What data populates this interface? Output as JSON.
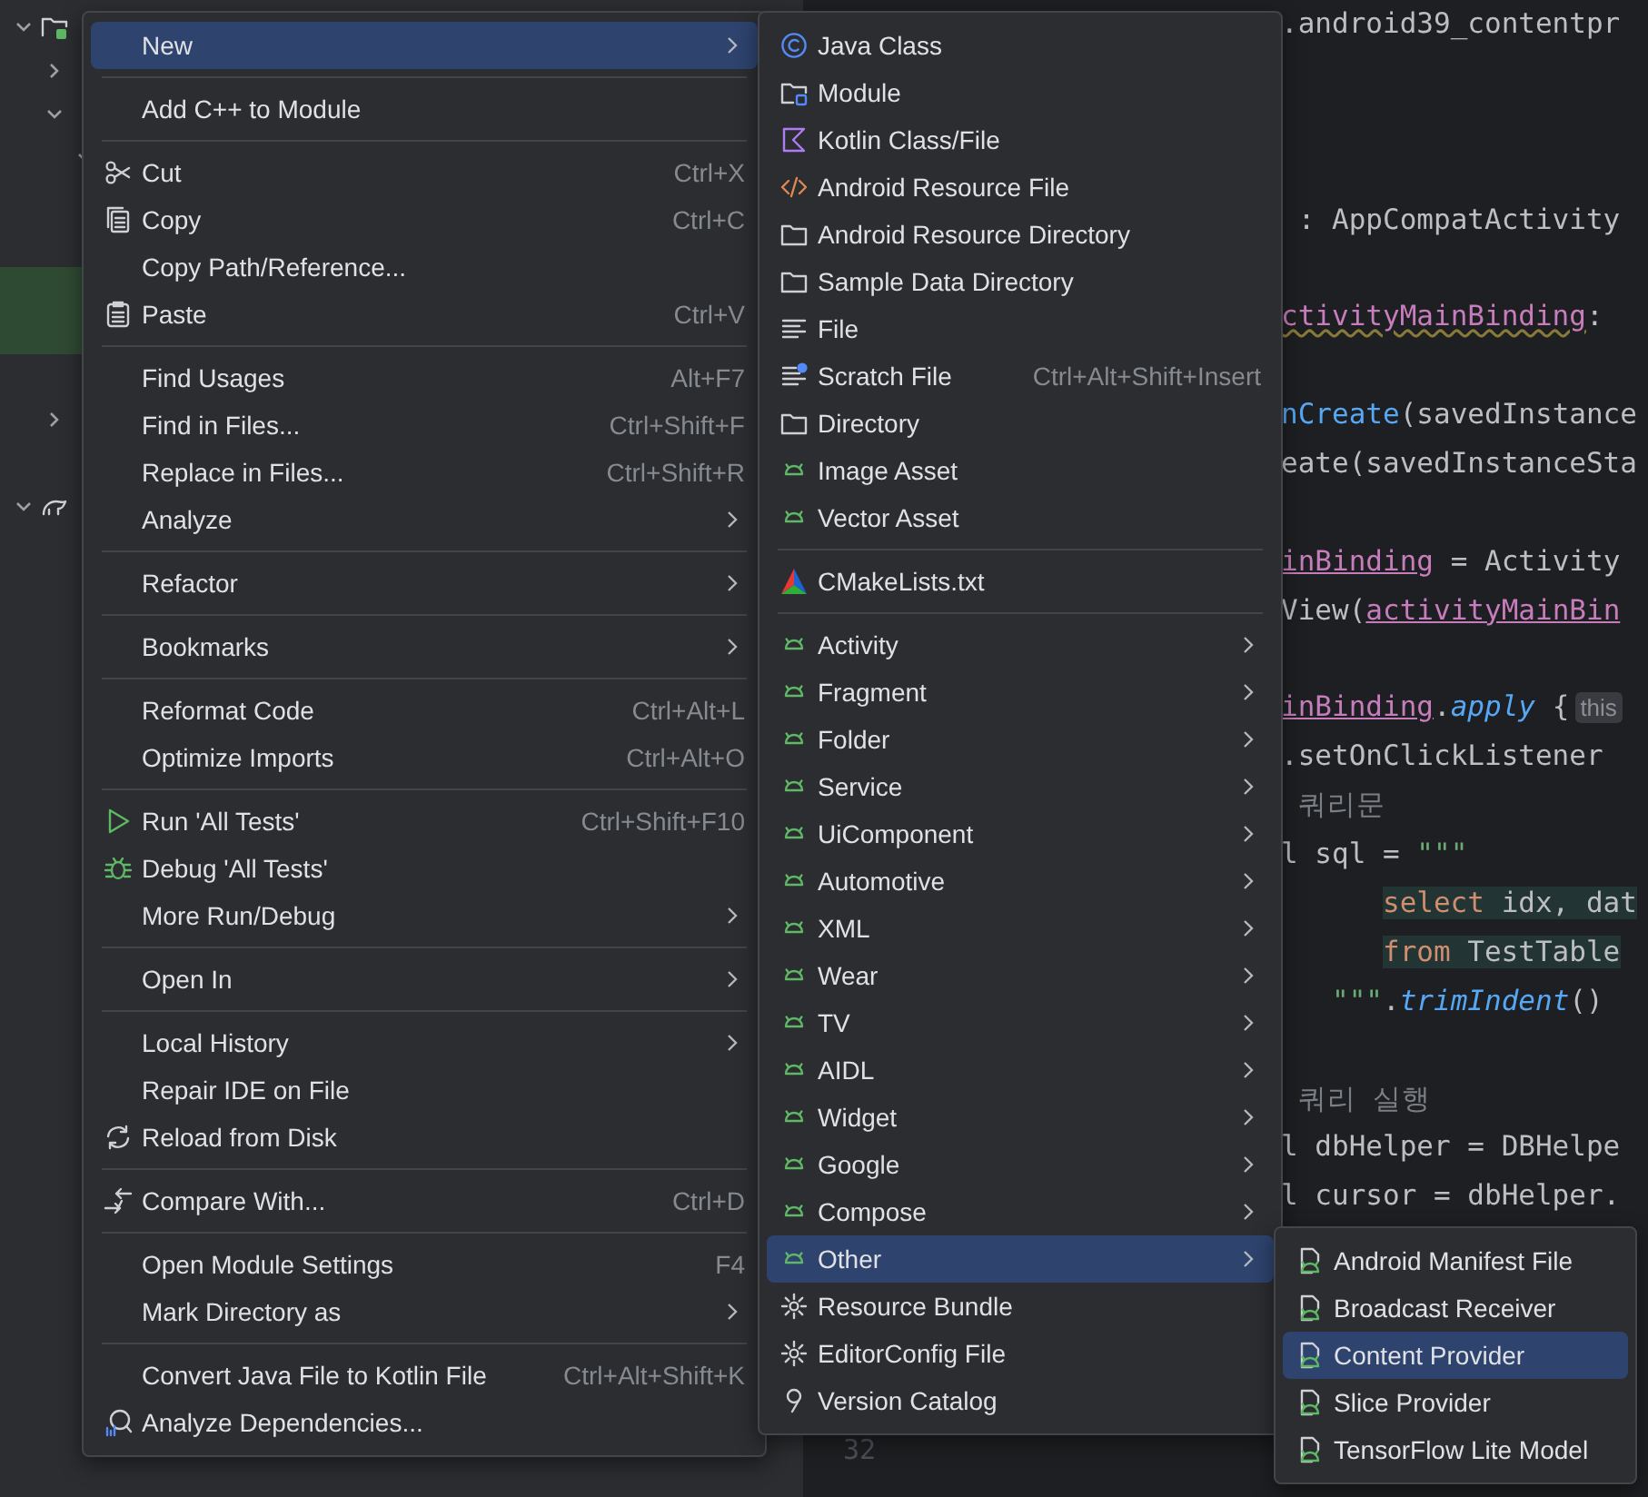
{
  "project_tree": [
    {
      "kind": "module",
      "expanded": true,
      "highlighted": false,
      "children": [
        {
          "expanded": false,
          "highlighted": false
        },
        {
          "expanded": true,
          "highlighted": false,
          "children": [
            {
              "expanded": true,
              "highlighted": false,
              "children": [
                {
                  "highlighted": false
                },
                {
                  "highlighted": false
                },
                {
                  "highlighted": true
                },
                {
                  "highlighted": true
                }
              ]
            }
          ]
        },
        {
          "highlighted": false
        },
        {
          "expanded": false,
          "highlighted": false
        },
        {
          "highlighted": false
        }
      ]
    },
    {
      "kind": "gradle",
      "expanded": true,
      "highlighted": false,
      "children": [
        {
          "highlighted": false
        },
        {
          "highlighted": false
        },
        {
          "highlighted": false
        },
        {
          "highlighted": false
        },
        {
          "highlighted": false
        },
        {
          "highlighted": false
        },
        {
          "highlighted": false
        }
      ]
    }
  ],
  "editor": {
    "code_lines": [
      {
        "kind": "code",
        "segments": [
          {
            "text": ".android39_contentpr",
            "kind": "plain"
          }
        ]
      },
      {
        "kind": "blank"
      },
      {
        "kind": "blank"
      },
      {
        "kind": "blank"
      },
      {
        "kind": "code",
        "segments": [
          {
            "text": " : AppCompatActivity",
            "kind": "plain"
          }
        ]
      },
      {
        "kind": "blank"
      },
      {
        "kind": "code",
        "segments": [
          {
            "text": "ctivityMainBinding",
            "kind": "property-warn"
          },
          {
            "text": ": ",
            "kind": "plain"
          }
        ]
      },
      {
        "kind": "blank"
      },
      {
        "kind": "code",
        "segments": [
          {
            "text": "nCreate",
            "kind": "function"
          },
          {
            "text": "(savedInstance",
            "kind": "plain"
          }
        ]
      },
      {
        "kind": "code",
        "segments": [
          {
            "text": "eate(savedInstanceSta",
            "kind": "plain"
          }
        ]
      },
      {
        "kind": "blank"
      },
      {
        "kind": "code",
        "segments": [
          {
            "text": "inBinding",
            "kind": "property"
          },
          {
            "text": " = Activity",
            "kind": "plain"
          }
        ]
      },
      {
        "kind": "code",
        "segments": [
          {
            "text": "View(",
            "kind": "plain"
          },
          {
            "text": "activityMainBin",
            "kind": "property"
          }
        ]
      },
      {
        "kind": "blank"
      },
      {
        "kind": "code",
        "segments": [
          {
            "text": "inBinding",
            "kind": "property"
          },
          {
            "text": ".",
            "kind": "plain"
          },
          {
            "text": "apply",
            "kind": "call"
          },
          {
            "text": " {",
            "kind": "plain"
          },
          {
            "text": "this",
            "kind": "hint"
          }
        ]
      },
      {
        "kind": "code",
        "segments": [
          {
            "text": ".setOnClickListener",
            "kind": "plain"
          }
        ]
      },
      {
        "kind": "code",
        "segments": [
          {
            "text": " 쿼리문",
            "kind": "comment"
          }
        ]
      },
      {
        "kind": "code",
        "segments": [
          {
            "text": "l sql = ",
            "kind": "plain"
          },
          {
            "text": "\"\"\"",
            "kind": "string"
          }
        ]
      },
      {
        "kind": "indented",
        "segments": [
          {
            "text": "select",
            "kind": "sql-keyword"
          },
          {
            "text": " idx, dat",
            "kind": "sql"
          }
        ]
      },
      {
        "kind": "indented",
        "segments": [
          {
            "text": "from",
            "kind": "sql-keyword"
          },
          {
            "text": " TestTable",
            "kind": "sql"
          }
        ]
      },
      {
        "kind": "half-indented",
        "segments": [
          {
            "text": "\"\"\"",
            "kind": "string"
          },
          {
            "text": ".",
            "kind": "plain"
          },
          {
            "text": "trimIndent",
            "kind": "call"
          },
          {
            "text": "()",
            "kind": "plain"
          }
        ]
      },
      {
        "kind": "blank"
      },
      {
        "kind": "code",
        "segments": [
          {
            "text": " 쿼리 실행",
            "kind": "comment"
          }
        ]
      },
      {
        "kind": "code",
        "segments": [
          {
            "text": "l dbHelper = DBHelpe",
            "kind": "plain"
          }
        ]
      },
      {
        "kind": "code",
        "segments": [
          {
            "text": "l cursor = dbHelper.",
            "kind": "plain"
          }
        ]
      }
    ],
    "line_number": "32"
  },
  "context_menu": {
    "items": [
      {
        "kind": "plain",
        "label": "New",
        "submenu": true,
        "selected": true
      },
      {
        "kind": "separator"
      },
      {
        "kind": "plain",
        "label": "Add C++ to Module",
        "submenu": false,
        "selected": false
      },
      {
        "kind": "separator"
      },
      {
        "kind": "scissors",
        "label": "Cut",
        "shortcut": "Ctrl+X",
        "submenu": false,
        "selected": false
      },
      {
        "kind": "copy",
        "label": "Copy",
        "shortcut": "Ctrl+C",
        "submenu": false,
        "selected": false
      },
      {
        "kind": "plain",
        "label": "Copy Path/Reference...",
        "submenu": false,
        "selected": false
      },
      {
        "kind": "paste",
        "label": "Paste",
        "shortcut": "Ctrl+V",
        "submenu": false,
        "selected": false
      },
      {
        "kind": "separator"
      },
      {
        "kind": "plain",
        "label": "Find Usages",
        "shortcut": "Alt+F7",
        "submenu": false,
        "selected": false
      },
      {
        "kind": "plain",
        "label": "Find in Files...",
        "shortcut": "Ctrl+Shift+F",
        "submenu": false,
        "selected": false
      },
      {
        "kind": "plain",
        "label": "Replace in Files...",
        "shortcut": "Ctrl+Shift+R",
        "submenu": false,
        "selected": false
      },
      {
        "kind": "plain",
        "label": "Analyze",
        "submenu": true,
        "selected": false
      },
      {
        "kind": "separator"
      },
      {
        "kind": "plain",
        "label": "Refactor",
        "submenu": true,
        "selected": false
      },
      {
        "kind": "separator"
      },
      {
        "kind": "plain",
        "label": "Bookmarks",
        "submenu": true,
        "selected": false
      },
      {
        "kind": "separator"
      },
      {
        "kind": "plain",
        "label": "Reformat Code",
        "shortcut": "Ctrl+Alt+L",
        "submenu": false,
        "selected": false
      },
      {
        "kind": "plain",
        "label": "Optimize Imports",
        "shortcut": "Ctrl+Alt+O",
        "submenu": false,
        "selected": false
      },
      {
        "kind": "separator"
      },
      {
        "kind": "run",
        "label": "Run 'All Tests'",
        "shortcut": "Ctrl+Shift+F10",
        "submenu": false,
        "selected": false
      },
      {
        "kind": "debug",
        "label": "Debug 'All Tests'",
        "submenu": false,
        "selected": false
      },
      {
        "kind": "plain",
        "label": "More Run/Debug",
        "submenu": true,
        "selected": false
      },
      {
        "kind": "separator"
      },
      {
        "kind": "plain",
        "label": "Open In",
        "submenu": true,
        "selected": false
      },
      {
        "kind": "separator"
      },
      {
        "kind": "plain",
        "label": "Local History",
        "submenu": true,
        "selected": false
      },
      {
        "kind": "plain",
        "label": "Repair IDE on File",
        "submenu": false,
        "selected": false
      },
      {
        "kind": "reload",
        "label": "Reload from Disk",
        "submenu": false,
        "selected": false
      },
      {
        "kind": "separator"
      },
      {
        "kind": "compare",
        "label": "Compare With...",
        "shortcut": "Ctrl+D",
        "submenu": false,
        "selected": false
      },
      {
        "kind": "separator"
      },
      {
        "kind": "plain",
        "label": "Open Module Settings",
        "shortcut": "F4",
        "submenu": false,
        "selected": false
      },
      {
        "kind": "plain",
        "label": "Mark Directory as",
        "submenu": true,
        "selected": false
      },
      {
        "kind": "separator"
      },
      {
        "kind": "plain",
        "label": "Convert Java File to Kotlin File",
        "shortcut": "Ctrl+Alt+Shift+K",
        "submenu": false,
        "selected": false
      },
      {
        "kind": "analyze",
        "label": "Analyze Dependencies...",
        "submenu": false,
        "selected": false
      }
    ]
  },
  "new_submenu": {
    "items": [
      {
        "kind": "java-class",
        "label": "Java Class",
        "submenu": false,
        "selected": false
      },
      {
        "kind": "module",
        "label": "Module",
        "submenu": false,
        "selected": false
      },
      {
        "kind": "kotlin",
        "label": "Kotlin Class/File",
        "submenu": false,
        "selected": false
      },
      {
        "kind": "xml",
        "label": "Android Resource File",
        "submenu": false,
        "selected": false
      },
      {
        "kind": "folder",
        "label": "Android Resource Directory",
        "submenu": false,
        "selected": false
      },
      {
        "kind": "folder",
        "label": "Sample Data Directory",
        "submenu": false,
        "selected": false
      },
      {
        "kind": "file",
        "label": "File",
        "submenu": false,
        "selected": false
      },
      {
        "kind": "scratch",
        "label": "Scratch File",
        "shortcut": "Ctrl+Alt+Shift+Insert",
        "submenu": false,
        "selected": false
      },
      {
        "kind": "folder",
        "label": "Directory",
        "submenu": false,
        "selected": false
      },
      {
        "kind": "android",
        "label": "Image Asset",
        "submenu": false,
        "selected": false
      },
      {
        "kind": "android",
        "label": "Vector Asset",
        "submenu": false,
        "selected": false
      },
      {
        "kind": "separator"
      },
      {
        "kind": "cmake",
        "label": "CMakeLists.txt",
        "submenu": false,
        "selected": false
      },
      {
        "kind": "separator"
      },
      {
        "kind": "android",
        "label": "Activity",
        "submenu": true,
        "selected": false
      },
      {
        "kind": "android",
        "label": "Fragment",
        "submenu": true,
        "selected": false
      },
      {
        "kind": "android",
        "label": "Folder",
        "submenu": true,
        "selected": false
      },
      {
        "kind": "android",
        "label": "Service",
        "submenu": true,
        "selected": false
      },
      {
        "kind": "android",
        "label": "UiComponent",
        "submenu": true,
        "selected": false
      },
      {
        "kind": "android",
        "label": "Automotive",
        "submenu": true,
        "selected": false
      },
      {
        "kind": "android",
        "label": "XML",
        "submenu": true,
        "selected": false
      },
      {
        "kind": "android",
        "label": "Wear",
        "submenu": true,
        "selected": false
      },
      {
        "kind": "android",
        "label": "TV",
        "submenu": true,
        "selected": false
      },
      {
        "kind": "android",
        "label": "AIDL",
        "submenu": true,
        "selected": false
      },
      {
        "kind": "android",
        "label": "Widget",
        "submenu": true,
        "selected": false
      },
      {
        "kind": "android",
        "label": "Google",
        "submenu": true,
        "selected": false
      },
      {
        "kind": "android",
        "label": "Compose",
        "submenu": true,
        "selected": false
      },
      {
        "kind": "android",
        "label": "Other",
        "submenu": true,
        "selected": true
      },
      {
        "kind": "gear",
        "label": "Resource Bundle",
        "submenu": false,
        "selected": false
      },
      {
        "kind": "gear",
        "label": "EditorConfig File",
        "submenu": false,
        "selected": false
      },
      {
        "kind": "catalog",
        "label": "Version Catalog",
        "submenu": false,
        "selected": false
      }
    ]
  },
  "other_submenu": {
    "items": [
      {
        "kind": "android-file",
        "label": "Android Manifest File",
        "submenu": false,
        "selected": false
      },
      {
        "kind": "android-file",
        "label": "Broadcast Receiver",
        "submenu": false,
        "selected": false
      },
      {
        "kind": "android-file",
        "label": "Content Provider",
        "submenu": false,
        "selected": true
      },
      {
        "kind": "android-file",
        "label": "Slice Provider",
        "submenu": false,
        "selected": false
      },
      {
        "kind": "android-file",
        "label": "TensorFlow Lite Model",
        "submenu": false,
        "selected": false
      }
    ]
  }
}
